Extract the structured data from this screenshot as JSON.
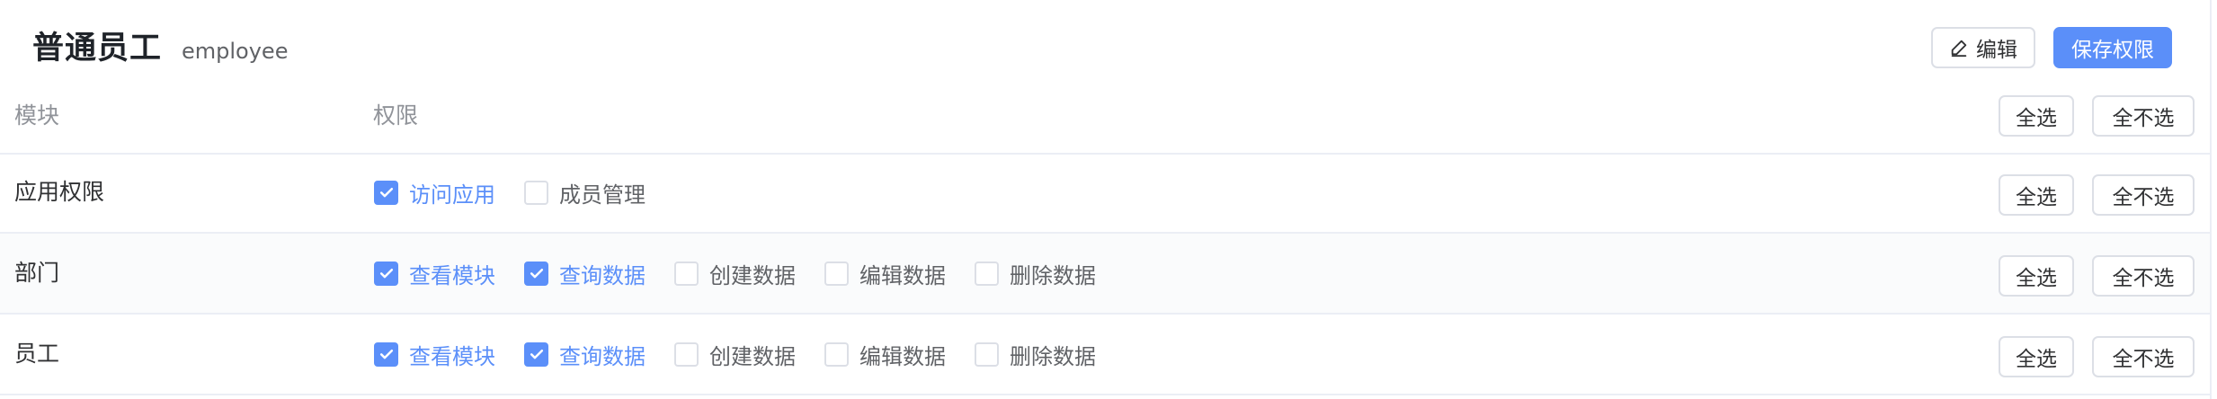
{
  "header": {
    "role_name": "普通员工",
    "role_code": "employee",
    "edit_label": "编辑",
    "save_label": "保存权限"
  },
  "table": {
    "col_module": "模块",
    "col_permission": "权限",
    "select_all_label": "全选",
    "unselect_all_label": "全不选"
  },
  "rows": [
    {
      "module": "应用权限",
      "select_all_label": "全选",
      "unselect_all_label": "全不选",
      "permissions": [
        {
          "label": "访问应用",
          "checked": true
        },
        {
          "label": "成员管理",
          "checked": false
        }
      ]
    },
    {
      "module": "部门",
      "select_all_label": "全选",
      "unselect_all_label": "全不选",
      "permissions": [
        {
          "label": "查看模块",
          "checked": true
        },
        {
          "label": "查询数据",
          "checked": true
        },
        {
          "label": "创建数据",
          "checked": false
        },
        {
          "label": "编辑数据",
          "checked": false
        },
        {
          "label": "删除数据",
          "checked": false
        }
      ]
    },
    {
      "module": "员工",
      "select_all_label": "全选",
      "unselect_all_label": "全不选",
      "permissions": [
        {
          "label": "查看模块",
          "checked": true
        },
        {
          "label": "查询数据",
          "checked": true
        },
        {
          "label": "创建数据",
          "checked": false
        },
        {
          "label": "编辑数据",
          "checked": false
        },
        {
          "label": "删除数据",
          "checked": false
        }
      ]
    }
  ],
  "colors": {
    "primary": "#5b8ff9",
    "border": "#dcdfe6",
    "text": "#303133",
    "muted": "#909399"
  },
  "icons": {
    "edit": "pencil-icon",
    "checkbox_checked": "check-icon"
  }
}
